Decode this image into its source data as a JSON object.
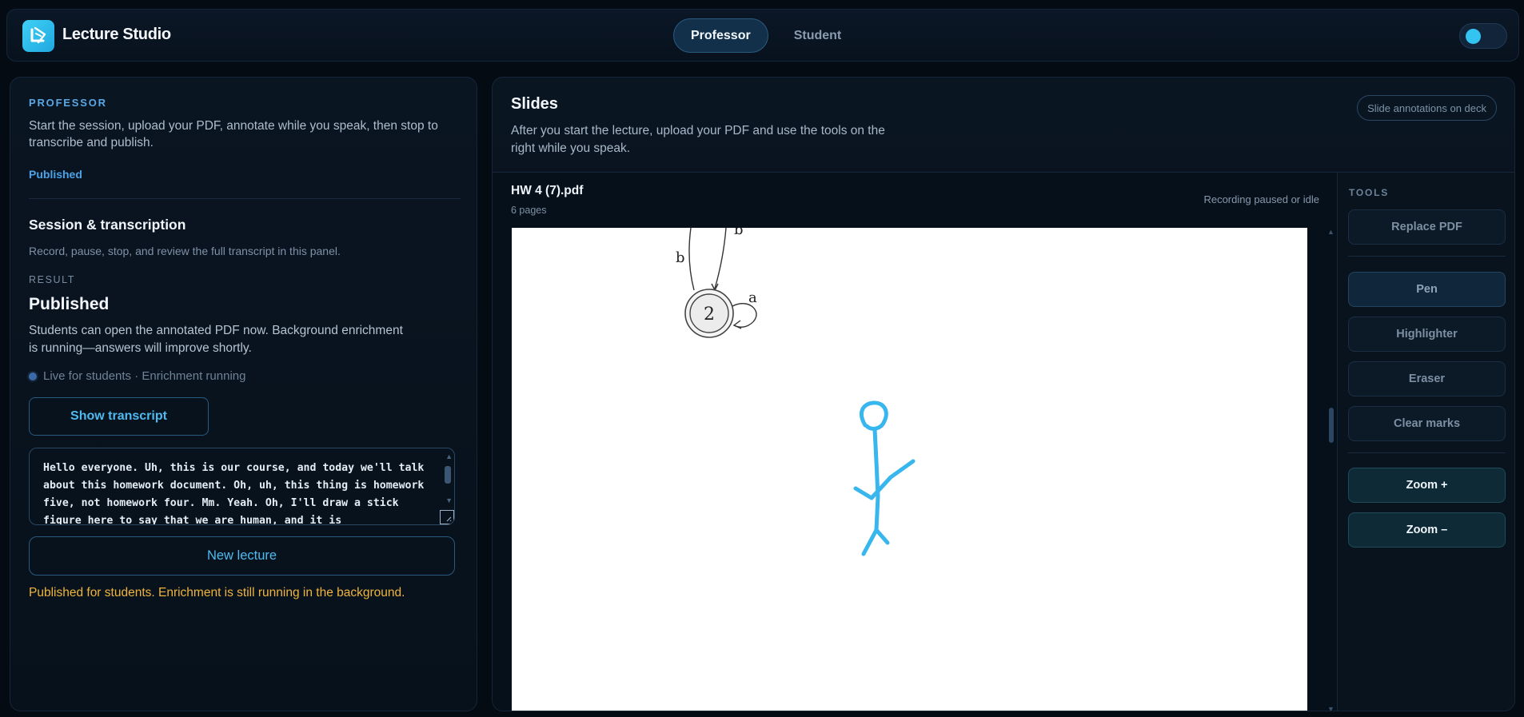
{
  "app": {
    "title": "Lecture Studio"
  },
  "roles": {
    "professor": "Professor",
    "student": "Student",
    "active": "Professor"
  },
  "left": {
    "eyebrow": "PROFESSOR",
    "intro": "Start the session, upload your PDF, annotate while you speak, then stop to transcribe and publish.",
    "status": "Published",
    "session_title": "Session & transcription",
    "session_sub": "Record, pause, stop, and review the full transcript in this panel.",
    "result_label": "RESULT",
    "result_title": "Published",
    "result_desc": "Students can open the annotated PDF now. Background enrichment is running—answers will improve shortly.",
    "live_status": "Live for students · Enrichment running",
    "show_transcript_label": "Show transcript",
    "transcript": "Hello everyone. Uh, this is our course, and today we'll talk about this homework document. Oh, uh, this thing is homework five, not homework four. Mm. Yeah. Oh, I'll draw a stick figure here to say that we are human, and it is",
    "new_lecture_label": "New lecture",
    "footnote": "Published for students. Enrichment is still running in the background."
  },
  "right": {
    "title": "Slides",
    "desc": "After you start the lecture, upload your PDF and use the tools on the right while you speak.",
    "chip": "Slide annotations on deck",
    "file_name": "HW 4 (7).pdf",
    "pages": "6 pages",
    "recording_status": "Recording paused or idle",
    "slide": {
      "state_label": "2",
      "edge_labels": [
        "b",
        "b",
        "a"
      ]
    }
  },
  "tools": {
    "label": "TOOLS",
    "replace_pdf": "Replace PDF",
    "pen": "Pen",
    "highlighter": "Highlighter",
    "eraser": "Eraser",
    "clear_marks": "Clear marks",
    "zoom_in": "Zoom +",
    "zoom_out": "Zoom –",
    "active_tool": "Pen"
  },
  "colors": {
    "accent": "#33c4f2",
    "annotation": "#38b6ee",
    "warning": "#f0b43c",
    "status_published": "#4aa3e8"
  }
}
